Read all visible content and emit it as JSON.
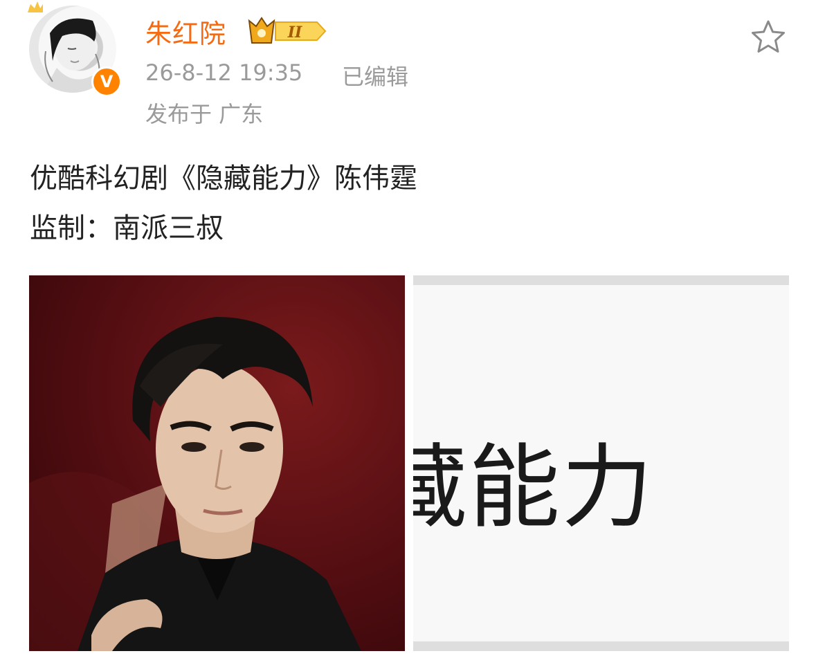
{
  "post": {
    "author": {
      "name": "朱红院",
      "member_level": "II",
      "avatar_icon": "avatar-portrait-icon",
      "verified_badge": "V"
    },
    "timestamp": "26-8-12 19:35",
    "edited_label": "已编辑",
    "location": "发布于 广东",
    "text_lines": [
      "优酷科幻剧《隐藏能力》陈伟霆",
      "监制：南派三叔"
    ],
    "images": [
      {
        "icon": "portrait-photo"
      },
      {
        "overlay_text": "藏能力"
      }
    ]
  },
  "colors": {
    "name": "#f56b13",
    "meta": "#9a9a9a",
    "verified": "#ff8200",
    "text": "#222222"
  }
}
